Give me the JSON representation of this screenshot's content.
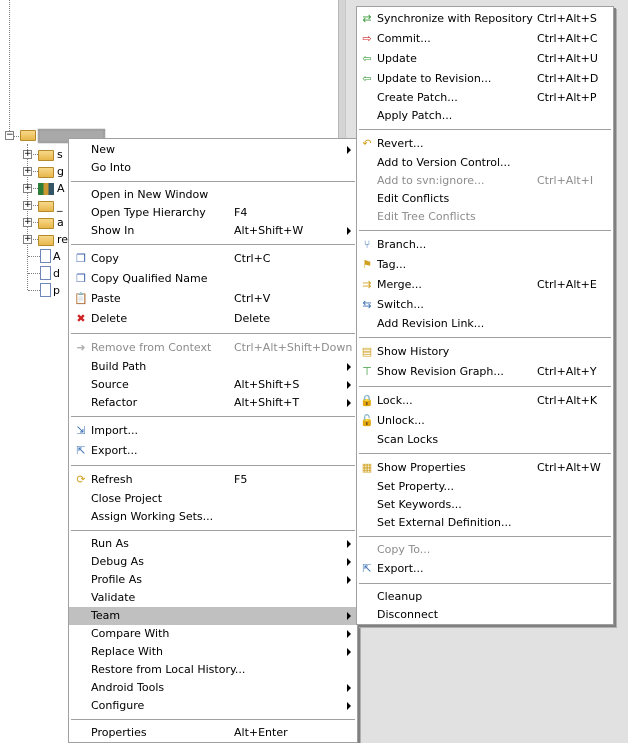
{
  "tree": {
    "root_label": "",
    "children": [
      {
        "label": "s",
        "icon": "project-folder-warning-icon",
        "expandable": true
      },
      {
        "label": "g",
        "icon": "project-folder-icon",
        "expandable": true
      },
      {
        "label": "A",
        "icon": "library-icon",
        "expandable": true
      },
      {
        "label": "_",
        "icon": "folder-icon",
        "expandable": true
      },
      {
        "label": "a",
        "icon": "svn-folder-icon",
        "expandable": true
      },
      {
        "label": "re",
        "icon": "svn-folder-icon",
        "expandable": true
      },
      {
        "label": "A",
        "icon": "manifest-file-warning-icon",
        "expandable": false
      },
      {
        "label": "d",
        "icon": "text-file-icon",
        "expandable": false
      },
      {
        "label": "p",
        "icon": "text-file-icon",
        "expandable": false
      }
    ]
  },
  "main_menu": [
    {
      "label": "New",
      "submenu": true
    },
    {
      "label": "Go Into"
    },
    {
      "sep": true
    },
    {
      "label": "Open in New Window"
    },
    {
      "label": "Open Type Hierarchy",
      "shortcut": "F4"
    },
    {
      "label": "Show In",
      "shortcut": "Alt+Shift+W",
      "submenu": true
    },
    {
      "sep": true
    },
    {
      "label": "Copy",
      "shortcut": "Ctrl+C",
      "icon": "copy-icon",
      "glyph": "❐",
      "color": "#3a5fa8"
    },
    {
      "label": "Copy Qualified Name",
      "icon": "copy-qualified-name-icon",
      "glyph": "❐",
      "color": "#3a5fa8"
    },
    {
      "label": "Paste",
      "shortcut": "Ctrl+V",
      "icon": "paste-icon",
      "glyph": "📋",
      "color": "#a07020"
    },
    {
      "label": "Delete",
      "shortcut": "Delete",
      "icon": "delete-icon",
      "glyph": "✖",
      "color": "#d02020"
    },
    {
      "sep": true
    },
    {
      "label": "Remove from Context",
      "shortcut": "Ctrl+Alt+Shift+Down",
      "icon": "remove-context-icon",
      "glyph": "➜",
      "color": "#b0b0b0",
      "disabled": true
    },
    {
      "label": "Build Path",
      "submenu": true
    },
    {
      "label": "Source",
      "shortcut": "Alt+Shift+S",
      "submenu": true
    },
    {
      "label": "Refactor",
      "shortcut": "Alt+Shift+T",
      "submenu": true
    },
    {
      "sep": true
    },
    {
      "label": "Import...",
      "icon": "import-icon",
      "glyph": "⇲",
      "color": "#3a6fb0"
    },
    {
      "label": "Export...",
      "icon": "export-icon",
      "glyph": "⇱",
      "color": "#3a6fb0"
    },
    {
      "sep": true
    },
    {
      "label": "Refresh",
      "shortcut": "F5",
      "icon": "refresh-icon",
      "glyph": "⟳",
      "color": "#d0a020"
    },
    {
      "label": "Close Project"
    },
    {
      "label": "Assign Working Sets..."
    },
    {
      "sep": true
    },
    {
      "label": "Run As",
      "submenu": true
    },
    {
      "label": "Debug As",
      "submenu": true
    },
    {
      "label": "Profile As",
      "submenu": true
    },
    {
      "label": "Validate"
    },
    {
      "label": "Team",
      "submenu": true,
      "selected": true
    },
    {
      "label": "Compare With",
      "submenu": true
    },
    {
      "label": "Replace With",
      "submenu": true
    },
    {
      "label": "Restore from Local History..."
    },
    {
      "label": "Android Tools",
      "submenu": true
    },
    {
      "label": "Configure",
      "submenu": true
    },
    {
      "sep": true
    },
    {
      "label": "Properties",
      "shortcut": "Alt+Enter"
    }
  ],
  "team_menu": [
    {
      "label": "Synchronize with Repository",
      "shortcut": "Ctrl+Alt+S",
      "icon": "synchronize-icon",
      "glyph": "⇄",
      "color": "#3a9a3a"
    },
    {
      "label": "Commit...",
      "shortcut": "Ctrl+Alt+C",
      "icon": "commit-icon",
      "glyph": "⇨",
      "color": "#d02020"
    },
    {
      "label": "Update",
      "shortcut": "Ctrl+Alt+U",
      "icon": "update-icon",
      "glyph": "⇦",
      "color": "#3a9a3a"
    },
    {
      "label": "Update to Revision...",
      "shortcut": "Ctrl+Alt+D",
      "icon": "update-to-revision-icon",
      "glyph": "⇦",
      "color": "#3a9a3a"
    },
    {
      "label": "Create Patch...",
      "shortcut": "Ctrl+Alt+P"
    },
    {
      "label": "Apply Patch..."
    },
    {
      "sep": true
    },
    {
      "label": "Revert...",
      "icon": "revert-icon",
      "glyph": "↶",
      "color": "#d0a020"
    },
    {
      "label": "Add to Version Control..."
    },
    {
      "label": "Add to svn:ignore...",
      "shortcut": "Ctrl+Alt+I",
      "disabled": true
    },
    {
      "label": "Edit Conflicts"
    },
    {
      "label": "Edit Tree Conflicts",
      "disabled": true
    },
    {
      "sep": true
    },
    {
      "label": "Branch...",
      "icon": "branch-icon",
      "glyph": "⑂",
      "color": "#3a6fb0"
    },
    {
      "label": "Tag...",
      "icon": "tag-icon",
      "glyph": "⚑",
      "color": "#d0a020"
    },
    {
      "label": "Merge...",
      "shortcut": "Ctrl+Alt+E",
      "icon": "merge-icon",
      "glyph": "⇉",
      "color": "#d0a020"
    },
    {
      "label": "Switch...",
      "icon": "switch-icon",
      "glyph": "⇆",
      "color": "#3a6fb0"
    },
    {
      "label": "Add Revision Link..."
    },
    {
      "sep": true
    },
    {
      "label": "Show History",
      "icon": "history-icon",
      "glyph": "▤",
      "color": "#d0a020"
    },
    {
      "label": "Show Revision Graph...",
      "shortcut": "Ctrl+Alt+Y",
      "icon": "revision-graph-icon",
      "glyph": "⊤",
      "color": "#3a9a3a"
    },
    {
      "sep": true
    },
    {
      "label": "Lock...",
      "shortcut": "Ctrl+Alt+K",
      "icon": "lock-icon",
      "glyph": "🔒",
      "color": "#c03030"
    },
    {
      "label": "Unlock...",
      "icon": "unlock-icon",
      "glyph": "🔓",
      "color": "#3a9a3a"
    },
    {
      "label": "Scan Locks"
    },
    {
      "sep": true
    },
    {
      "label": "Show Properties",
      "shortcut": "Ctrl+Alt+W",
      "icon": "properties-icon",
      "glyph": "▦",
      "color": "#d0a020"
    },
    {
      "label": "Set Property..."
    },
    {
      "label": "Set Keywords..."
    },
    {
      "label": "Set External Definition..."
    },
    {
      "sep": true
    },
    {
      "label": "Copy To...",
      "disabled": true
    },
    {
      "label": "Export...",
      "icon": "export-icon",
      "glyph": "⇱",
      "color": "#3a6fb0"
    },
    {
      "sep": true
    },
    {
      "label": "Cleanup"
    },
    {
      "label": "Disconnect"
    }
  ]
}
